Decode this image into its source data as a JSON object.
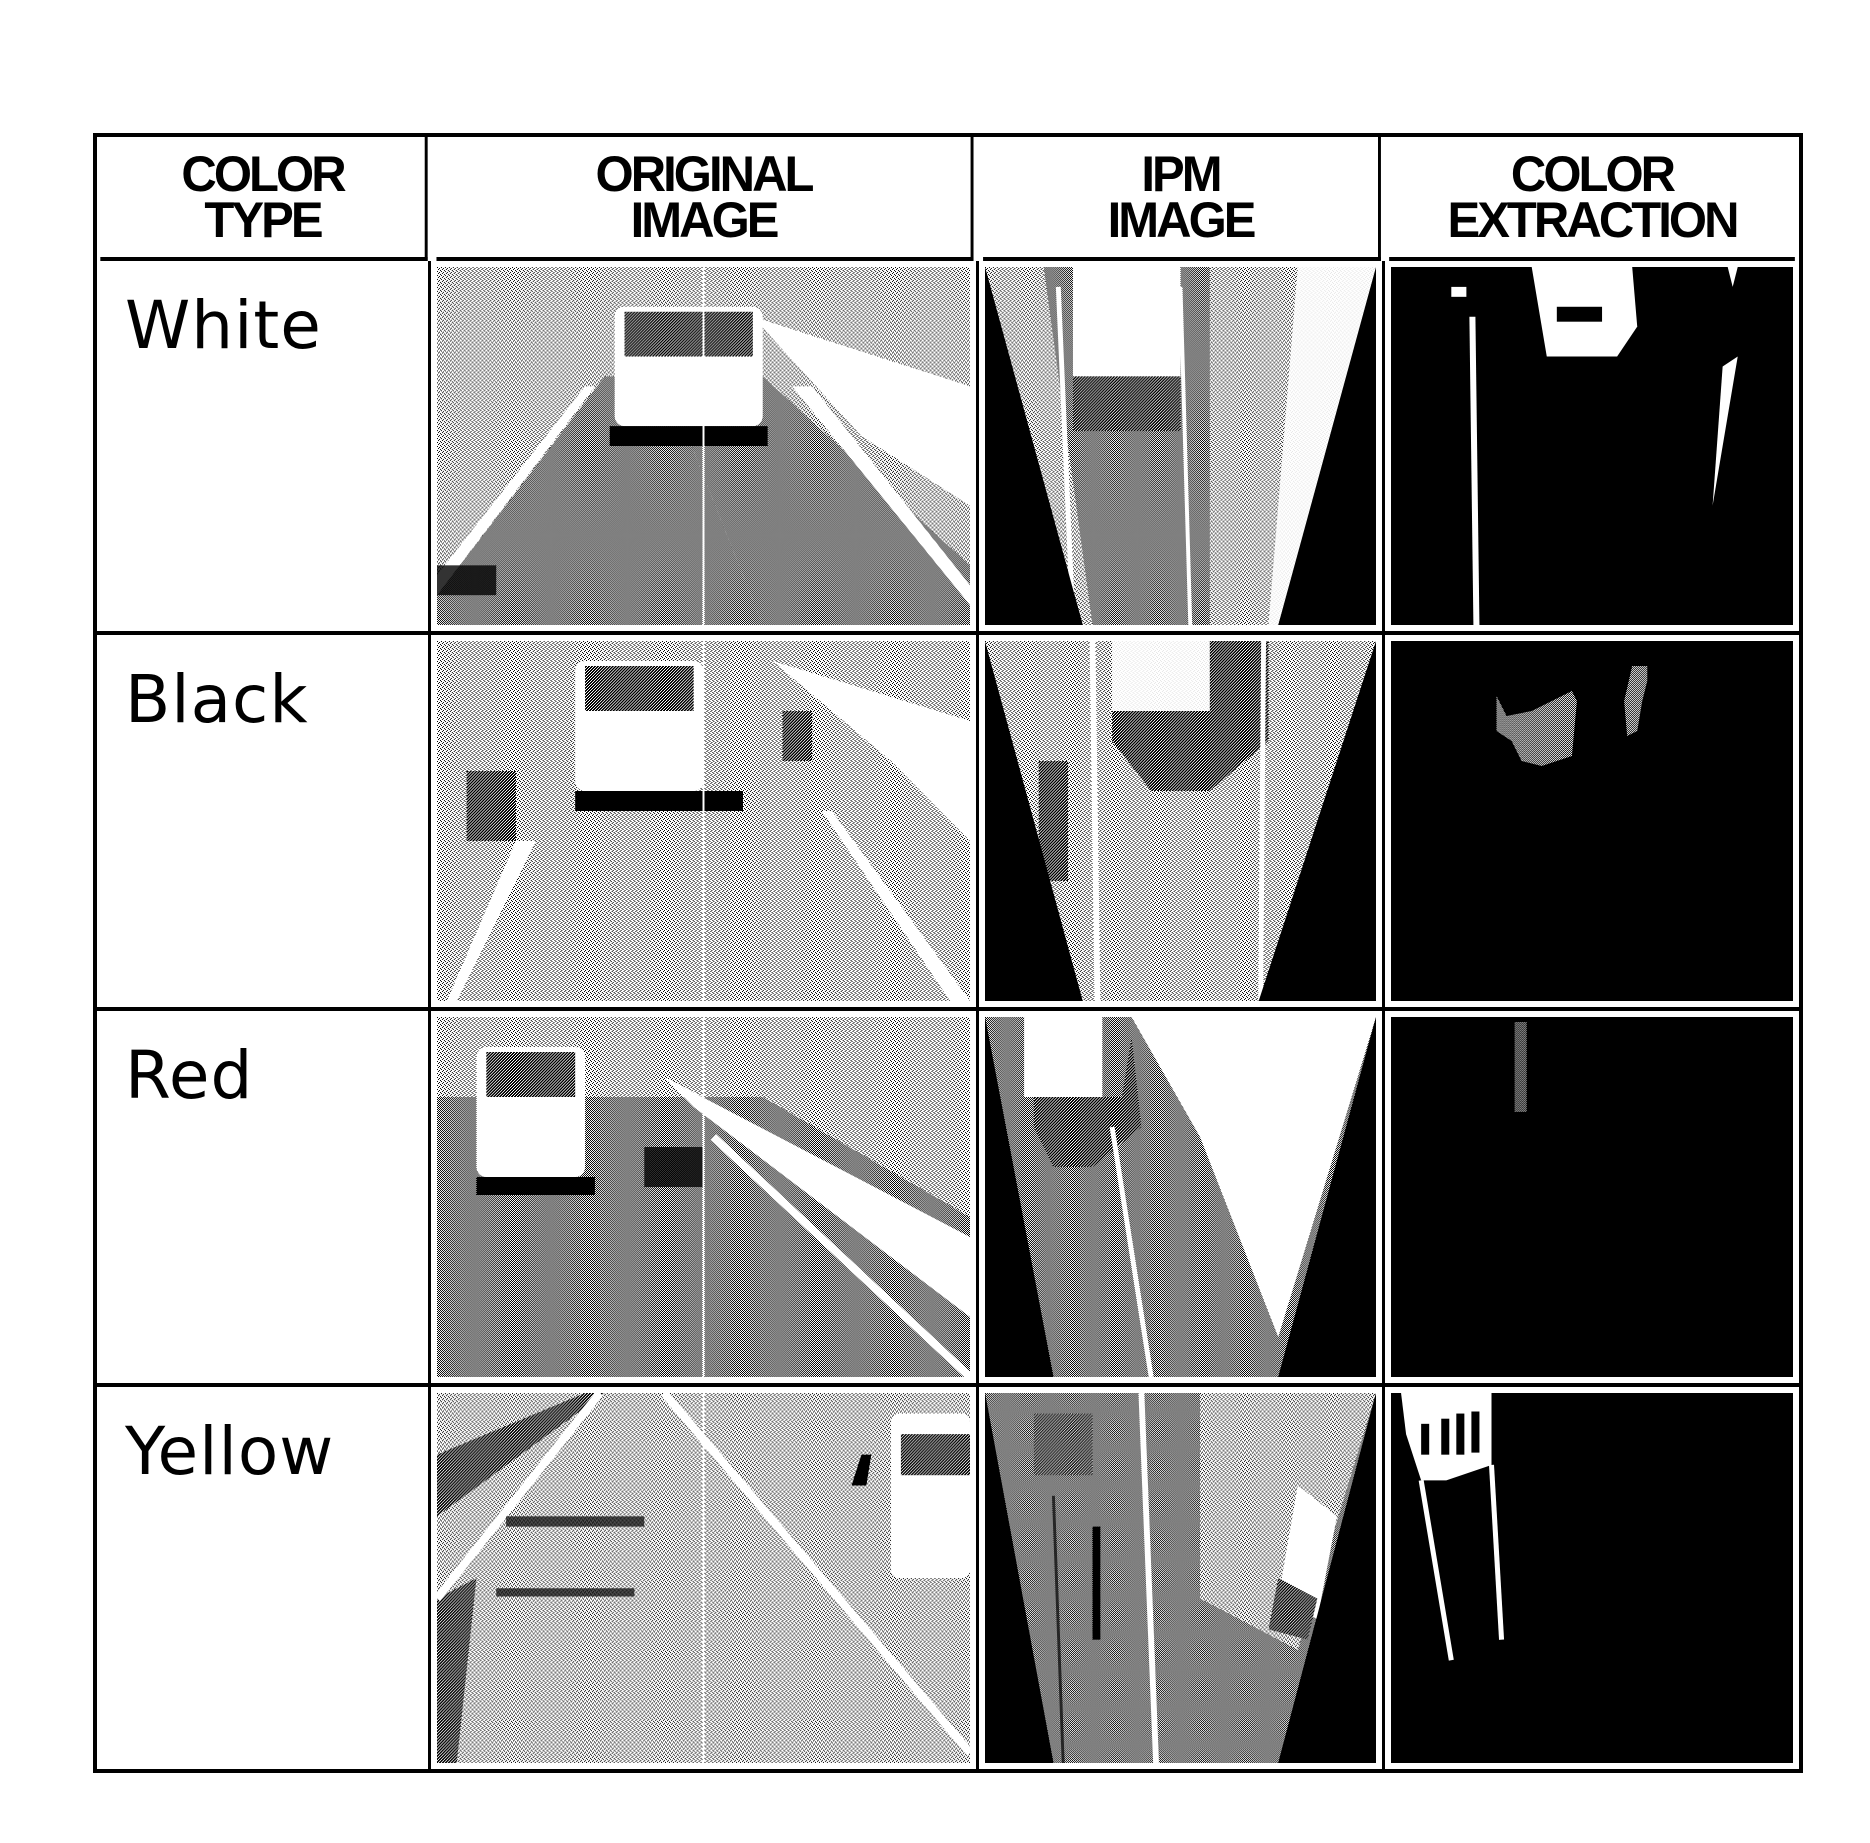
{
  "figure": {
    "headers": [
      {
        "line1": "COLOR",
        "line2": "TYPE"
      },
      {
        "line1": "ORIGINAL",
        "line2": "IMAGE"
      },
      {
        "line1": "IPM",
        "line2": "IMAGE"
      },
      {
        "line1": "COLOR",
        "line2": "EXTRACTION"
      }
    ],
    "rows": [
      {
        "color_type": "White",
        "original_image": "road scene with white van ahead, white lane lines",
        "ipm_image": "bird's-eye view of lane with van",
        "color_extraction": "white lane marking and van highlights extracted"
      },
      {
        "color_type": "Black",
        "original_image": "road scene with van and black-striped bollards",
        "ipm_image": "bird's-eye view with bollards",
        "color_extraction": "two dark blobs extracted"
      },
      {
        "color_type": "Red",
        "original_image": "road scene with van near median barrier",
        "ipm_image": "bird's-eye view with van and barrier",
        "color_extraction": "small red region extracted"
      },
      {
        "color_type": "Yellow",
        "original_image": "road scene with barrier gate and cones",
        "ipm_image": "bird's-eye view with gate and lines",
        "color_extraction": "yellow gate and lines extracted"
      }
    ]
  }
}
